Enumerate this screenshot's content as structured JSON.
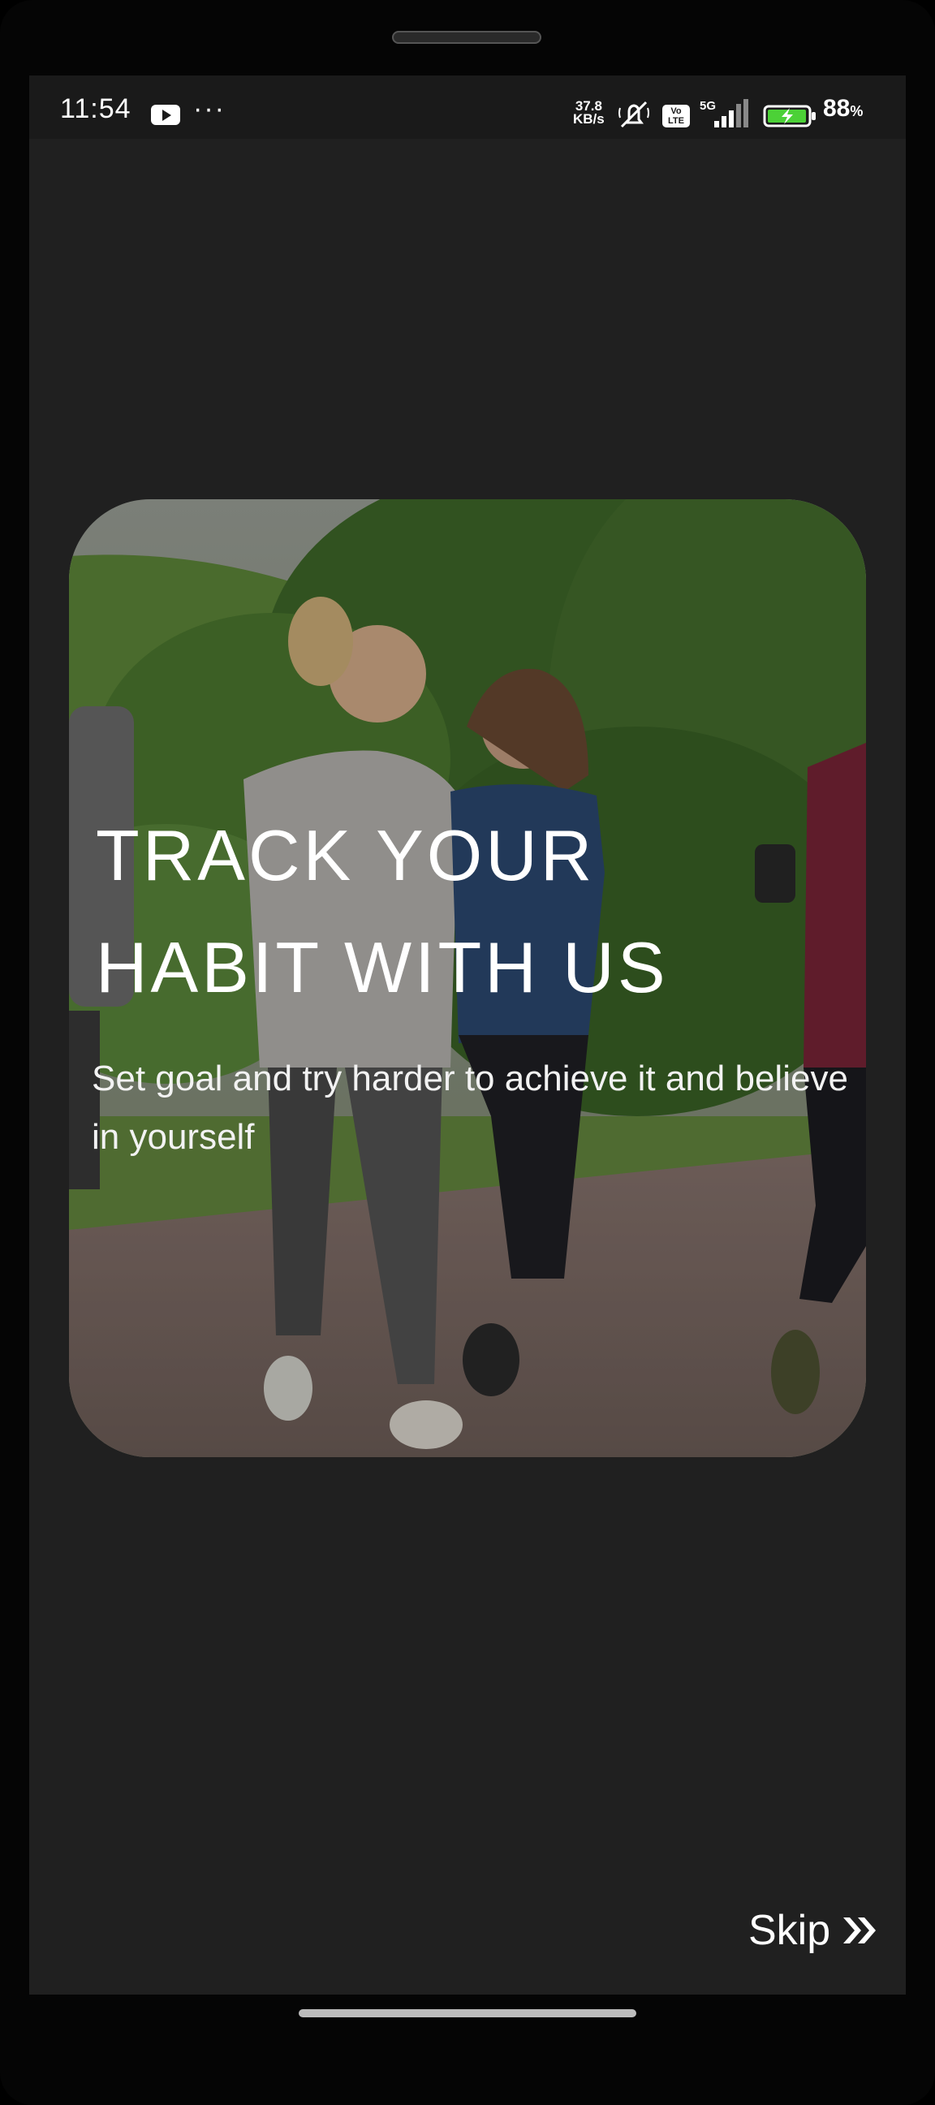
{
  "status_bar": {
    "time": "11:54",
    "overflow_dots": "···",
    "net_speed_value": "37.8",
    "net_speed_unit": "KB/s",
    "volte_line1": "Vo",
    "volte_line2": "LTE",
    "network_type": "5G",
    "battery_percent": "88",
    "battery_percent_sign": "%",
    "icons": [
      "youtube-icon",
      "mute-icon",
      "volte-icon",
      "signal-icon",
      "battery-charging-icon"
    ]
  },
  "onboarding": {
    "headline_line1": "TRACK YOUR",
    "headline_line2": "HABIT WITH US",
    "subtitle": "Set goal and try harder to achieve it and believe in yourself",
    "image_subject": "people jogging outdoors"
  },
  "navigation": {
    "skip_label": "Skip",
    "skip_icon": "double-chevron-right-icon"
  },
  "colors": {
    "background": "#202020",
    "text": "#ffffff",
    "battery_fill": "#4cd137"
  }
}
